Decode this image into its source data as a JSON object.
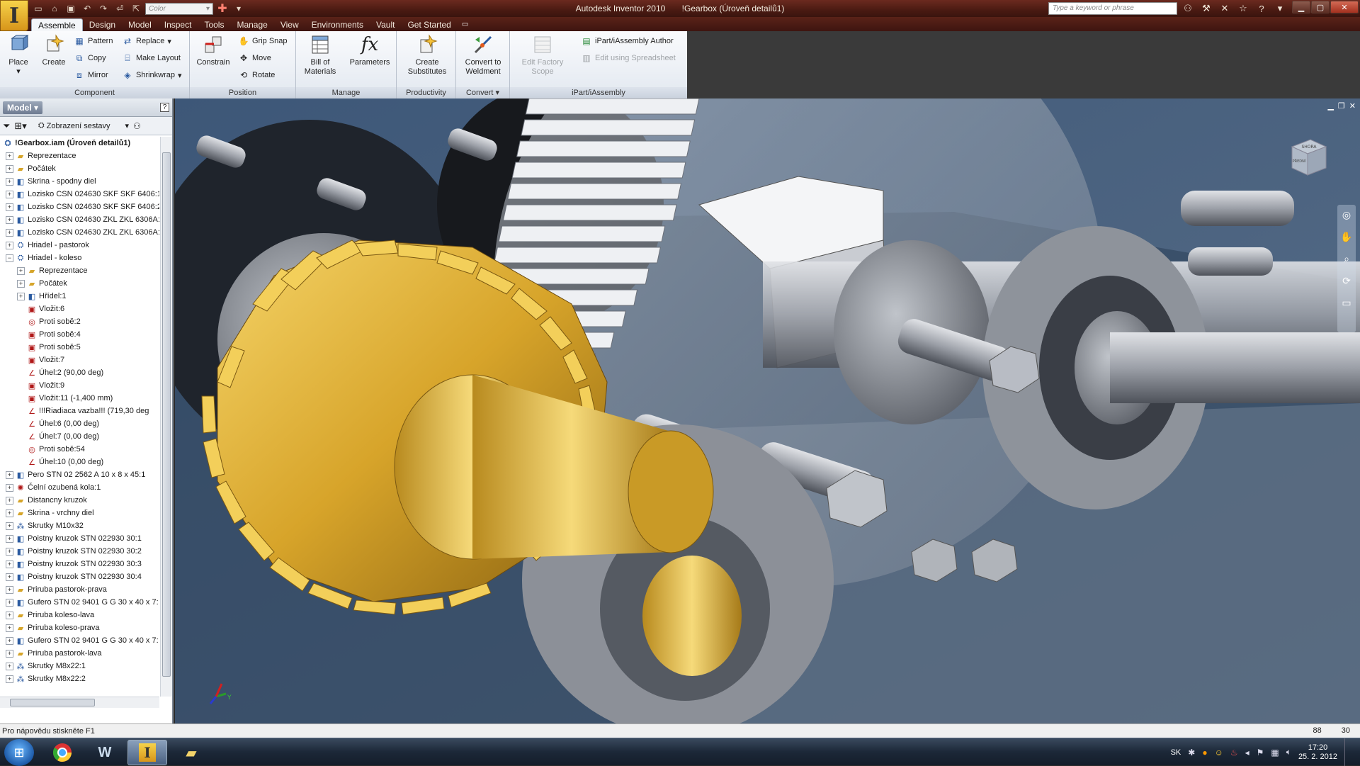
{
  "window": {
    "app_name": "Autodesk Inventor 2010",
    "document_title": "!Gearbox (Úroveň detailů1)"
  },
  "quick_access": {
    "color_placeholder": "Color"
  },
  "search": {
    "placeholder": "Type a keyword or phrase"
  },
  "tabs": [
    {
      "label": "Assemble",
      "active": true
    },
    {
      "label": "Design"
    },
    {
      "label": "Model"
    },
    {
      "label": "Inspect"
    },
    {
      "label": "Tools"
    },
    {
      "label": "Manage"
    },
    {
      "label": "View"
    },
    {
      "label": "Environments"
    },
    {
      "label": "Vault"
    },
    {
      "label": "Get Started"
    }
  ],
  "ribbon": {
    "component": {
      "title": "Component",
      "place": "Place",
      "create": "Create",
      "pattern": "Pattern",
      "copy": "Copy",
      "mirror": "Mirror",
      "replace": "Replace",
      "make_layout": "Make Layout",
      "shrinkwrap": "Shrinkwrap"
    },
    "position": {
      "title": "Position",
      "constrain": "Constrain",
      "grip_snap": "Grip Snap",
      "move": "Move",
      "rotate": "Rotate"
    },
    "manage": {
      "title": "Manage",
      "bom_1": "Bill of",
      "bom_2": "Materials",
      "parameters": "Parameters"
    },
    "productivity": {
      "title": "Productivity",
      "create_subs_1": "Create",
      "create_subs_2": "Substitutes"
    },
    "convert": {
      "title": "Convert",
      "convert_1": "Convert to",
      "convert_2": "Weldment"
    },
    "factory": {
      "edit_1": "Edit Factory",
      "edit_2": "Scope"
    },
    "ipart": {
      "title": "iPart/iAssembly",
      "author": "iPart/iAssembly Author",
      "edit_spreadsheet": "Edit using Spreadsheet"
    }
  },
  "browser": {
    "model_label": "Model",
    "view_label": "Zobrazení sestavy",
    "tree": [
      {
        "label": "!Gearbox.iam (Úroveň detailů1)",
        "level": 0,
        "icon": "assembly",
        "root": true
      },
      {
        "label": "Reprezentace",
        "level": 0,
        "icon": "folder",
        "exp": "+"
      },
      {
        "label": "Počátek",
        "level": 0,
        "icon": "folder",
        "exp": "+"
      },
      {
        "label": "Skrina - spodny diel",
        "level": 0,
        "icon": "part",
        "exp": "+"
      },
      {
        "label": "Lozisko CSN 024630 SKF SKF 6406:1",
        "level": 0,
        "icon": "part",
        "exp": "+"
      },
      {
        "label": "Lozisko CSN 024630 SKF SKF 6406:2",
        "level": 0,
        "icon": "part",
        "exp": "+"
      },
      {
        "label": "Lozisko CSN 024630 ZKL ZKL 6306A:1",
        "level": 0,
        "icon": "part",
        "exp": "+"
      },
      {
        "label": "Lozisko CSN 024630 ZKL ZKL 6306A:2",
        "level": 0,
        "icon": "part",
        "exp": "+"
      },
      {
        "label": "Hriadel - pastorok",
        "level": 0,
        "icon": "assembly",
        "exp": "+"
      },
      {
        "label": "Hriadel - koleso",
        "level": 0,
        "icon": "assembly",
        "exp": "−"
      },
      {
        "label": "Reprezentace",
        "level": 1,
        "icon": "folder",
        "exp": "+"
      },
      {
        "label": "Počátek",
        "level": 1,
        "icon": "folder",
        "exp": "+"
      },
      {
        "label": "Hřídel:1",
        "level": 1,
        "icon": "part",
        "exp": "+"
      },
      {
        "label": "Vložit:6",
        "level": 1,
        "icon": "constraint"
      },
      {
        "label": "Proti sobě:2",
        "level": 1,
        "icon": "mate"
      },
      {
        "label": "Proti sobě:4",
        "level": 1,
        "icon": "constraint"
      },
      {
        "label": "Proti sobě:5",
        "level": 1,
        "icon": "constraint"
      },
      {
        "label": "Vložit:7",
        "level": 1,
        "icon": "constraint"
      },
      {
        "label": "Úhel:2 (90,00 deg)",
        "level": 1,
        "icon": "angle"
      },
      {
        "label": "Vložit:9",
        "level": 1,
        "icon": "constraint"
      },
      {
        "label": "Vložit:11 (-1,400 mm)",
        "level": 1,
        "icon": "constraint"
      },
      {
        "label": "!!!Riadiaca vazba!!! (719,30 deg",
        "level": 1,
        "icon": "angle"
      },
      {
        "label": "Úhel:6 (0,00 deg)",
        "level": 1,
        "icon": "angle"
      },
      {
        "label": "Úhel:7 (0,00 deg)",
        "level": 1,
        "icon": "angle"
      },
      {
        "label": "Proti sobě:54",
        "level": 1,
        "icon": "mate"
      },
      {
        "label": "Úhel:10 (0,00 deg)",
        "level": 1,
        "icon": "angle"
      },
      {
        "label": "Pero STN 02 2562 A 10 x 8 x 45:1",
        "level": 0,
        "icon": "part",
        "exp": "+"
      },
      {
        "label": "Čelní ozubená kola:1",
        "level": 0,
        "icon": "gear",
        "exp": "+"
      },
      {
        "label": "Distancny kruzok",
        "level": 0,
        "icon": "folder",
        "exp": "+"
      },
      {
        "label": "Skrina - vrchny diel",
        "level": 0,
        "icon": "folder",
        "exp": "+"
      },
      {
        "label": "Skrutky M10x32",
        "level": 0,
        "icon": "pattern",
        "exp": "+"
      },
      {
        "label": "Poistny kruzok STN 022930 30:1",
        "level": 0,
        "icon": "part",
        "exp": "+"
      },
      {
        "label": "Poistny kruzok STN 022930 30:2",
        "level": 0,
        "icon": "part",
        "exp": "+"
      },
      {
        "label": "Poistny kruzok STN 022930 30:3",
        "level": 0,
        "icon": "part",
        "exp": "+"
      },
      {
        "label": "Poistny kruzok STN 022930 30:4",
        "level": 0,
        "icon": "part",
        "exp": "+"
      },
      {
        "label": "Priruba pastorok-prava",
        "level": 0,
        "icon": "folder",
        "exp": "+"
      },
      {
        "label": "Gufero STN 02 9401 G G 30 x 40 x 7:",
        "level": 0,
        "icon": "part",
        "exp": "+"
      },
      {
        "label": "Priruba koleso-lava",
        "level": 0,
        "icon": "folder",
        "exp": "+"
      },
      {
        "label": "Priruba koleso-prava",
        "level": 0,
        "icon": "folder",
        "exp": "+"
      },
      {
        "label": "Gufero STN 02 9401 G G 30 x 40 x 7:",
        "level": 0,
        "icon": "part",
        "exp": "+"
      },
      {
        "label": "Priruba pastorok-lava",
        "level": 0,
        "icon": "folder",
        "exp": "+"
      },
      {
        "label": "Skrutky M8x22:1",
        "level": 0,
        "icon": "pattern",
        "exp": "+"
      },
      {
        "label": "Skrutky M8x22:2",
        "level": 0,
        "icon": "pattern",
        "exp": "+"
      }
    ]
  },
  "viewcube": {
    "front": "PŘEDNÍ",
    "top": "SHORA"
  },
  "status": {
    "help_text": "Pro nápovědu stiskněte F1",
    "count_1": "88",
    "count_2": "30"
  },
  "taskbar": {
    "lang": "SK",
    "time": "17:20",
    "date": "25. 2. 2012"
  },
  "colors": {
    "titlebar": "#4a1a12",
    "ribbon_bg": "#eef1f6",
    "gear_gold": "#d7a42a",
    "viewport_bg": "#4a5f7d"
  }
}
